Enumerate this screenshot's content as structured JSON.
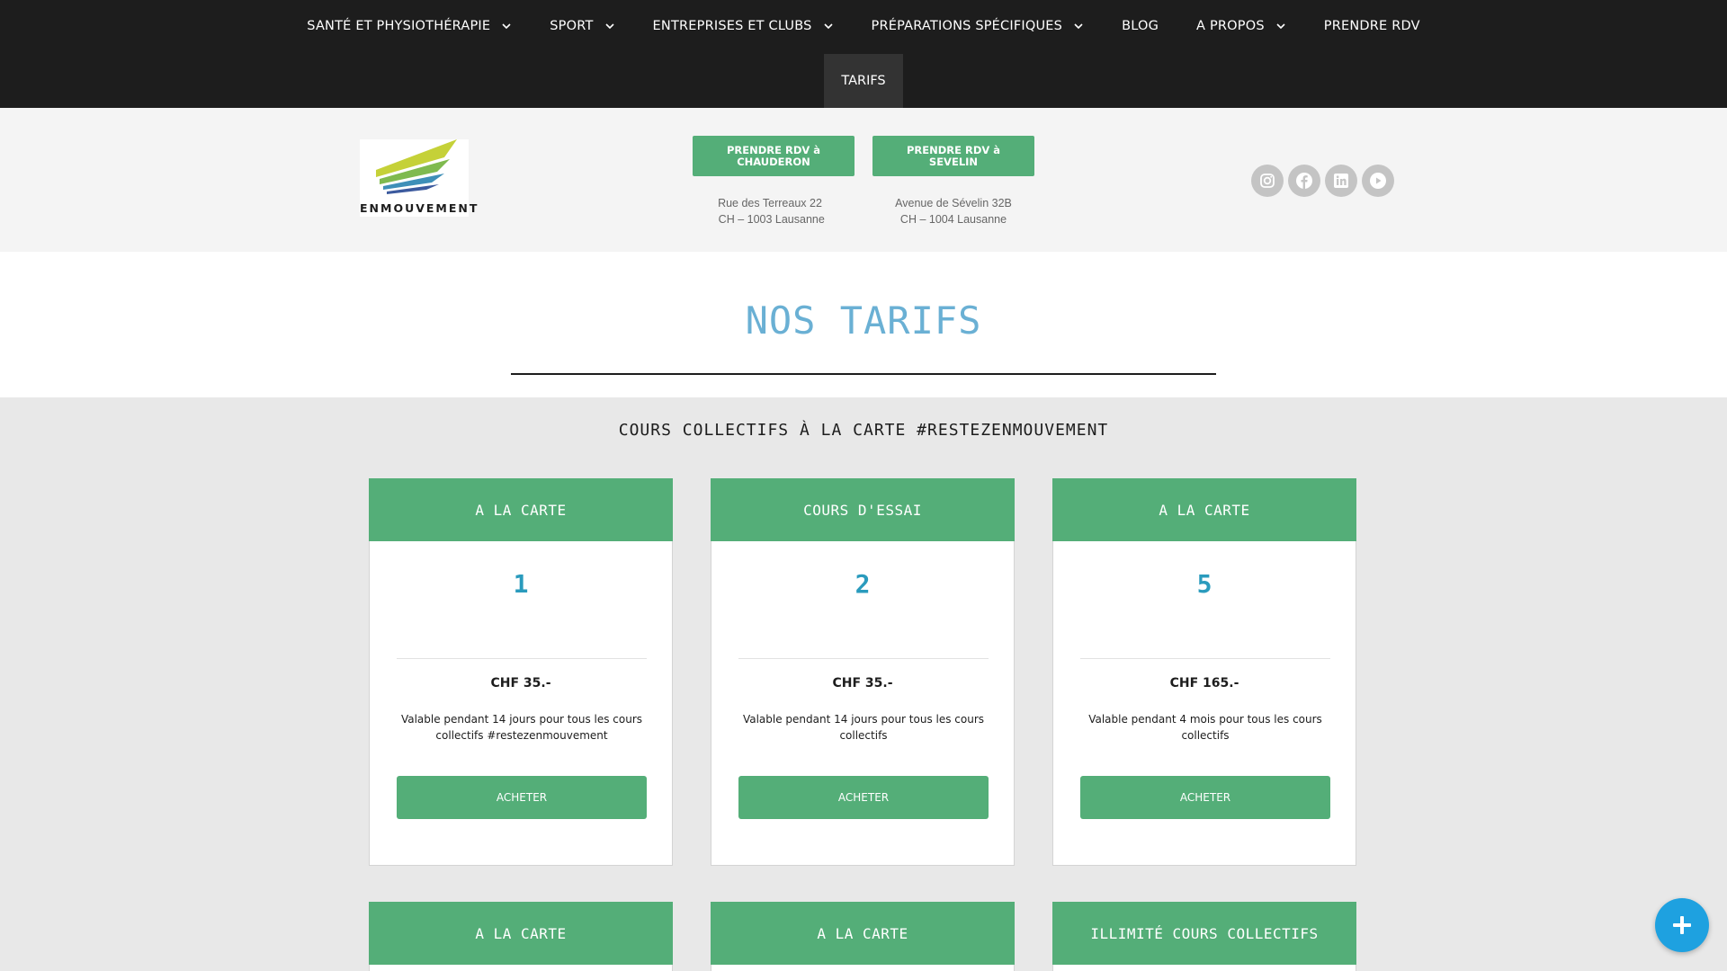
{
  "nav": {
    "items": [
      {
        "label": "SANTÉ ET PHYSIOTHÉRAPIE",
        "dropdown": true
      },
      {
        "label": "SPORT",
        "dropdown": true
      },
      {
        "label": "ENTREPRISES ET CLUBS",
        "dropdown": true
      },
      {
        "label": "PRÉPARATIONS SPÉCIFIQUES",
        "dropdown": true
      },
      {
        "label": "BLOG",
        "dropdown": false
      },
      {
        "label": "A PROPOS",
        "dropdown": true
      },
      {
        "label": "PRENDRE RDV",
        "dropdown": false
      }
    ],
    "active": "TARIFS"
  },
  "header": {
    "logo_text": "ENMOUVEMENT",
    "cta_chauderon": "PRENDRE RDV à CHAUDERON",
    "cta_sevelin": "PRENDRE RDV à SEVELIN",
    "address_chauderon": [
      "Rue des Terreaux 22",
      " CH – 1003 Lausanne"
    ],
    "address_sevelin": [
      "Avenue de Sévelin 32B",
      "CH – 1004 Lausanne"
    ],
    "social_icons": [
      "instagram-icon",
      "facebook-icon",
      "linkedin-icon",
      "youtube-icon"
    ]
  },
  "title": "NOS TARIFS",
  "section_heading": "COURS COLLECTIFS À LA CARTE #RESTEZENMOUVEMENT",
  "cards": [
    {
      "header": "A LA CARTE",
      "count": "1",
      "price": "CHF 35.-",
      "description": "Valable pendant 14 jours pour tous les cours collectifs #restezenmouvement",
      "button": "ACHETER"
    },
    {
      "header": "COURS D'ESSAI",
      "count": "2",
      "price": "CHF 35.-",
      "description": "Valable pendant 14 jours pour tous les cours collectifs",
      "button": "ACHETER"
    },
    {
      "header": "A LA CARTE",
      "count": "5",
      "price": "CHF 165.-",
      "description": "Valable pendant 4 mois pour tous les cours collectifs",
      "button": "ACHETER"
    },
    {
      "header": "A LA CARTE"
    },
    {
      "header": "A LA CARTE"
    },
    {
      "header": "ILLIMITÉ COURS COLLECTIFS"
    }
  ],
  "colors": {
    "nav_bg": "#1d1d1d",
    "accent_green": "#54ae78",
    "title_blue": "#6ab0d4",
    "count_blue": "#2a9bbd",
    "fab_blue": "#1ea1e0"
  },
  "fab_icon": "plus-icon"
}
